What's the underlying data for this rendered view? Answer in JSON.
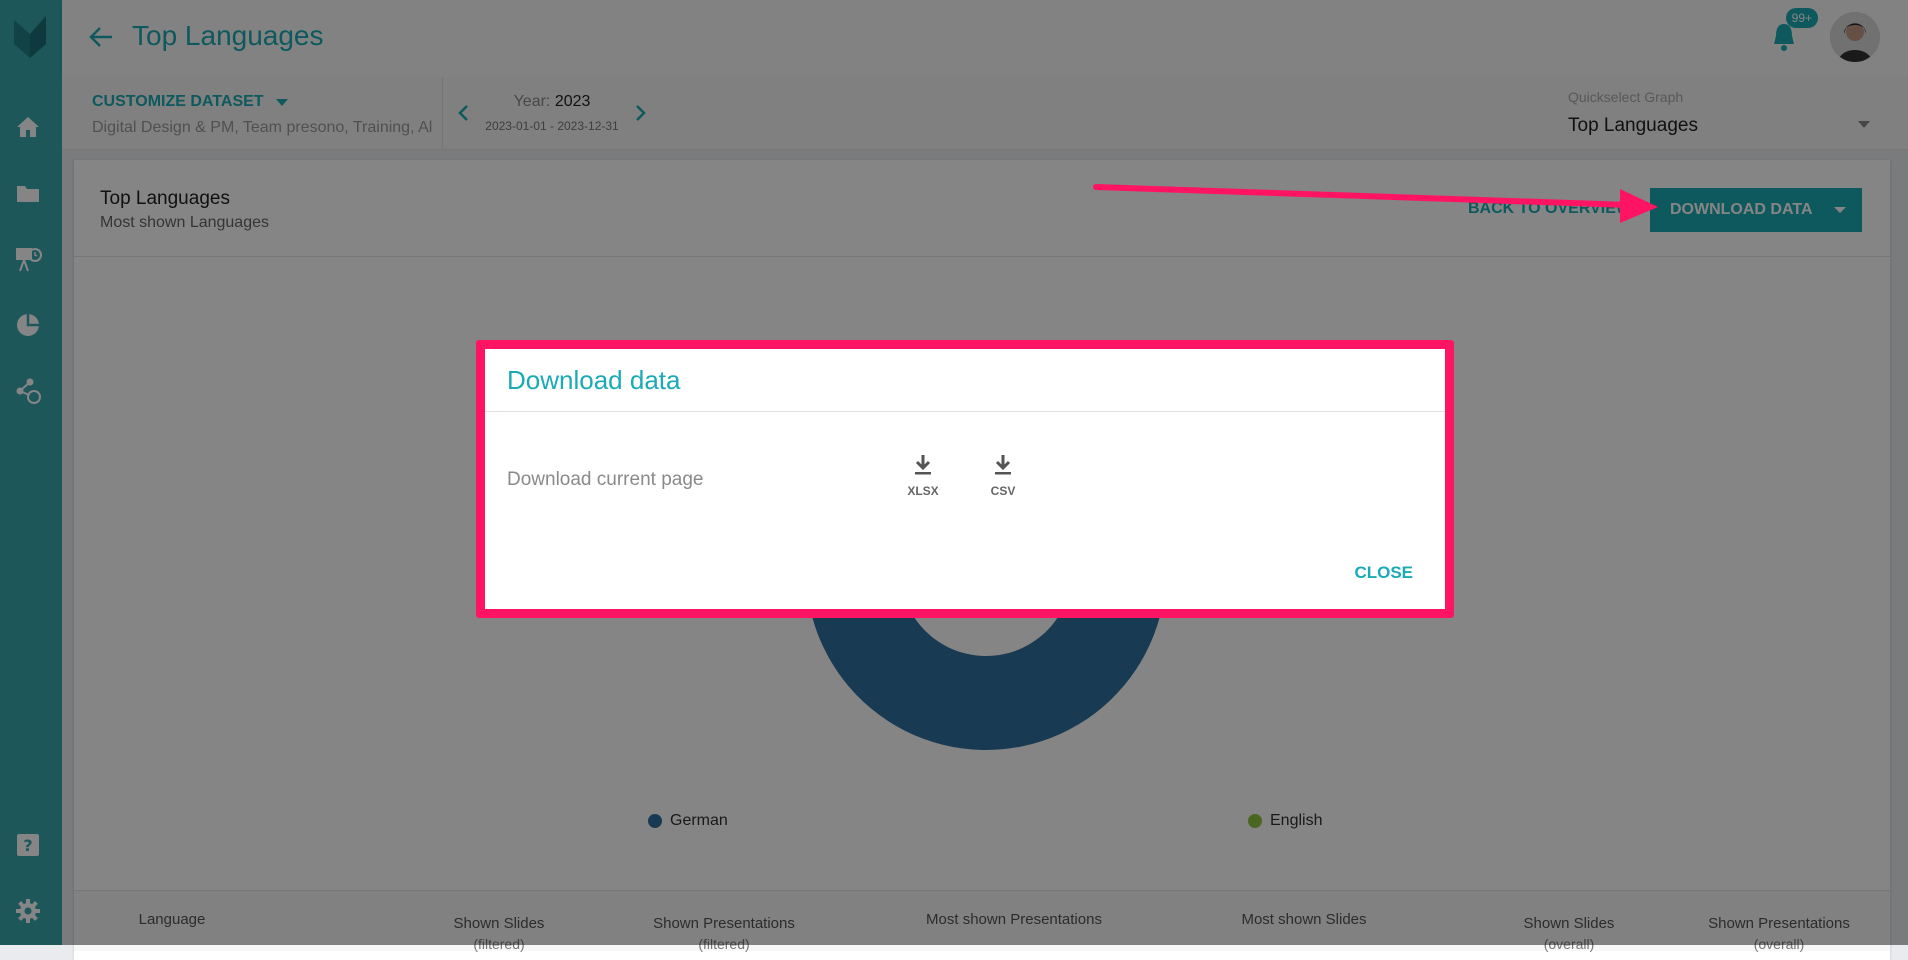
{
  "header": {
    "title": "Top Languages",
    "notification_count": "99+"
  },
  "toolbar": {
    "customize_label": "CUSTOMIZE DATASET",
    "dataset_list": "Digital Design & PM, Team presono, Training, All",
    "year_prefix": "Year: ",
    "year": "2023",
    "year_range": "2023-01-01 - 2023-12-31",
    "quickselect_label": "Quickselect Graph",
    "quickselect_value": "Top Languages"
  },
  "card": {
    "title": "Top Languages",
    "subtitle": "Most shown Languages",
    "back_label": "BACK TO OVERVIEW",
    "download_label": "DOWNLOAD DATA"
  },
  "chart_data": {
    "type": "pie",
    "categories": [
      "German",
      "English"
    ],
    "values": [
      86,
      14
    ],
    "colors": [
      "#2f6f9e",
      "#8cc63f"
    ]
  },
  "table": {
    "headers": [
      {
        "label": "Language",
        "sub": ""
      },
      {
        "label": "Shown Slides",
        "sub": "(filtered)"
      },
      {
        "label": "Shown Presentations",
        "sub": "(filtered)"
      },
      {
        "label": "Most shown Presentations",
        "sub": ""
      },
      {
        "label": "Most shown Slides",
        "sub": ""
      },
      {
        "label": "Shown Slides",
        "sub": "(overall)"
      },
      {
        "label": "Shown Presentations",
        "sub": "(overall)"
      }
    ]
  },
  "modal": {
    "title": "Download data",
    "row_label": "Download current page",
    "xlsx_label": "XLSX",
    "csv_label": "CSV",
    "close_label": "CLOSE"
  }
}
